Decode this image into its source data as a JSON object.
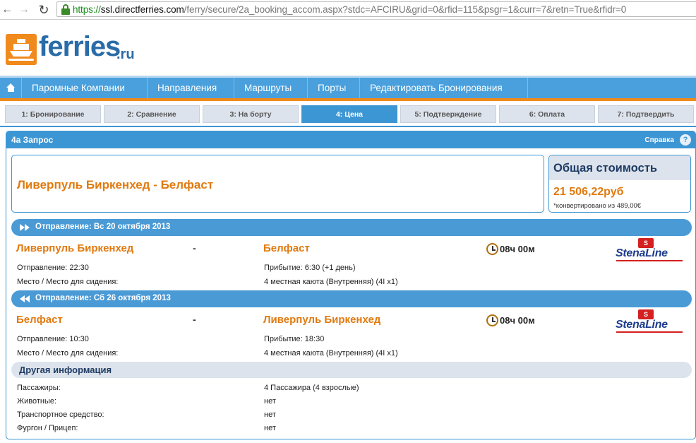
{
  "browser": {
    "url_proto": "https://",
    "url_host": "ssl.directferries.com",
    "url_path": "/ferry/secure/2a_booking_accom.aspx?stdc=AFCIRU&grid=0&rfid=115&psgr=1&curr=7&retn=True&rfidr=0"
  },
  "logo": {
    "word": "ferries",
    "tld": ".ru"
  },
  "nav": {
    "items": [
      "Паромные Компании",
      "Направления",
      "Маршруты",
      "Порты",
      "Редактировать Бронирования"
    ]
  },
  "steps": [
    "1: Бронирование",
    "2: Сравнение",
    "3: На борту",
    "4: Цена",
    "5: Подтверждение",
    "6: Оплата",
    "7: Подтвердить"
  ],
  "active_step": 3,
  "panel": {
    "title": "4а Запрос",
    "help": "Справка",
    "help_icon": "?"
  },
  "route_title": "Ливерпуль Биркенхед - Белфаст",
  "total": {
    "label": "Общая стоимость",
    "price": "21 506,22руб",
    "converted": "*конвертировано из 489,00€"
  },
  "outbound": {
    "header": "Отправление: Вс 20 октября 2013",
    "from": "Ливерпуль Биркенхед",
    "dash": "-",
    "to": "Белфаст",
    "duration": "08ч 00м",
    "departure": "Отправление: 22:30",
    "arrival": "Прибытие: 6:30 (+1 день)",
    "seat_label": "Место / Место для сидения:",
    "seat_value": "4 местная каюта (Внутренняя) (4I x1)",
    "operator_flag": "S",
    "operator": "StenaLine"
  },
  "return": {
    "header": "Отправление: Сб 26 октября 2013",
    "from": "Белфаст",
    "dash": "-",
    "to": "Ливерпуль Биркенхед",
    "duration": "08ч 00м",
    "departure": "Отправление: 10:30",
    "arrival": "Прибытие: 18:30",
    "seat_label": "Место / Место для сидения:",
    "seat_value": "4 местная каюта (Внутренняя) (4I x1)",
    "operator_flag": "S",
    "operator": "StenaLine"
  },
  "other": {
    "title": "Другая информация",
    "rows": [
      {
        "label": "Пассажиры:",
        "value": "4 Пассажира (4 взрослые)"
      },
      {
        "label": "Животные:",
        "value": "нет"
      },
      {
        "label": "Транспортное средство:",
        "value": "нет"
      },
      {
        "label": "Фургон / Прицеп:",
        "value": "нет"
      }
    ]
  },
  "colors": {
    "accent": "#3d96d4",
    "orange": "#e07a10",
    "navy": "#1e3c64"
  }
}
